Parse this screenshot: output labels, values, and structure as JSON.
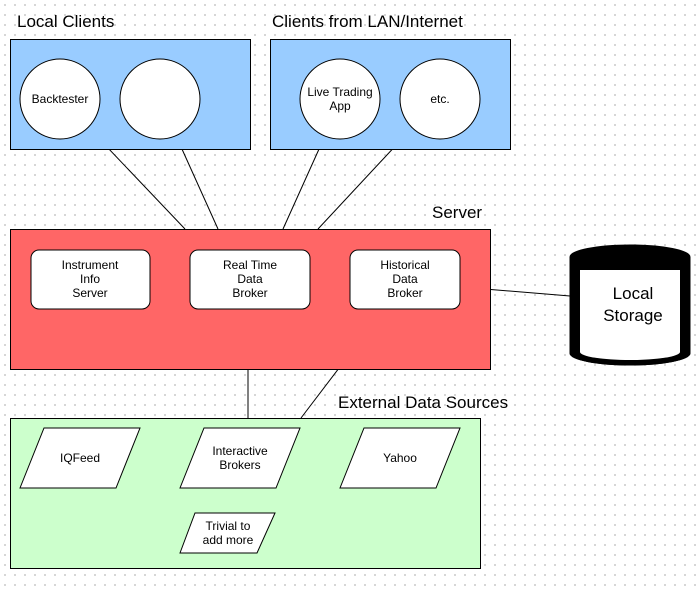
{
  "groups": {
    "local_clients": {
      "title": "Local Clients",
      "color": "#99ccff",
      "items": [
        "Backtester",
        ""
      ]
    },
    "remote_clients": {
      "title": "Clients from LAN/Internet",
      "color": "#99ccff",
      "items": [
        "Live Trading|App",
        "etc."
      ]
    },
    "server": {
      "title": "Server",
      "color": "#ff6666",
      "items": [
        "Instrument|Info|Server",
        "Real Time|Data|Broker",
        "Historical|Data|Broker"
      ]
    },
    "external": {
      "title": "External Data Sources",
      "color": "#ccffcc",
      "items": [
        "IQFeed",
        "Interactive|Brokers",
        "Yahoo",
        "Trivial to|add more"
      ]
    }
  },
  "storage": {
    "label": "Local|Storage"
  }
}
